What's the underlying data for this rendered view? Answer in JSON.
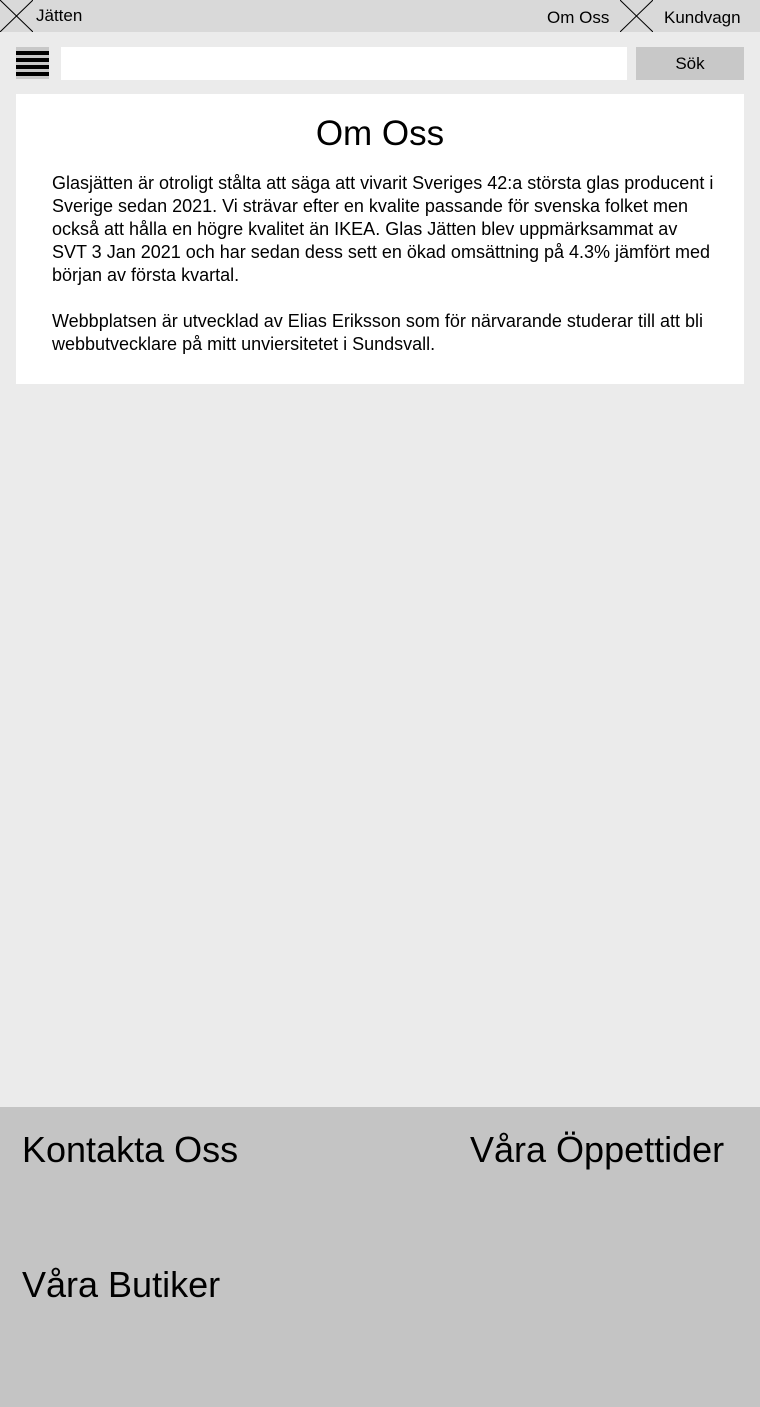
{
  "header": {
    "brand": "Jätten",
    "nav_about": "Om Oss",
    "nav_cart": "Kundvagn",
    "logo_icon": "placeholder-x-icon",
    "cart_icon": "placeholder-x-icon"
  },
  "search": {
    "value": "",
    "placeholder": "",
    "button_label": "Sök",
    "menu_icon": "hamburger-menu-icon"
  },
  "main": {
    "title": "Om Oss",
    "paragraph1": "Glasjätten är otroligt stålta att säga att vivarit Sveriges 42:a största glas producent i Sverige sedan 2021. Vi strävar efter en kvalite passande för svenska folket men också att hålla en högre kvalitet än IKEA. Glas Jätten blev uppmärksammat av SVT 3 Jan 2021 och har sedan dess sett en ökad omsättning på 4.3% jämfört med början av första kvartal.",
    "paragraph2": "Webbplatsen är utvecklad av Elias Eriksson som för närvarande studerar till att bli webbutvecklare på mitt unviersitetet i Sundsvall."
  },
  "footer": {
    "contact": "Kontakta Oss",
    "hours": "Våra Öppettider",
    "stores": "Våra Butiker"
  },
  "colors": {
    "page_bg": "#ebebeb",
    "topbar_bg": "#d9d9d9",
    "button_bg": "#c8c8c8",
    "footer_bg": "#c4c4c4",
    "card_bg": "#ffffff"
  }
}
